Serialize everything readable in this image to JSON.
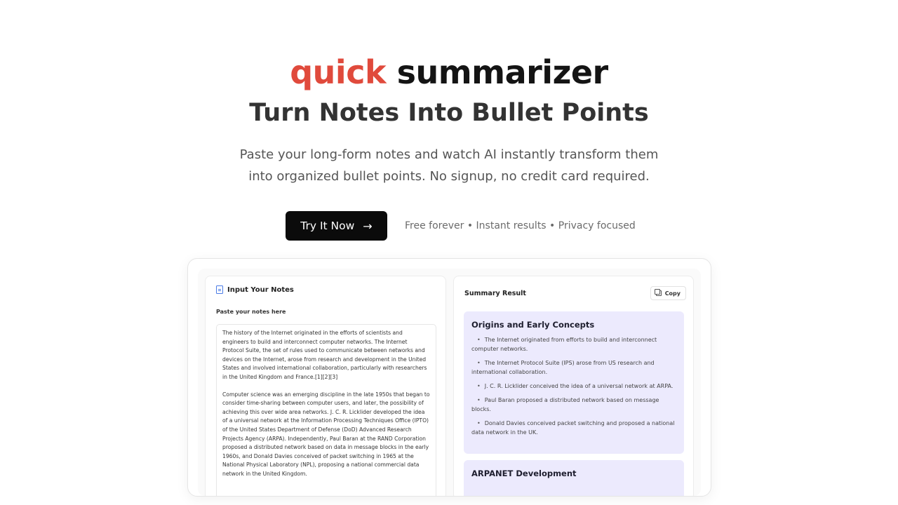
{
  "hero": {
    "title_accent": "quick",
    "title_main": "summarizer",
    "subtitle": "Turn Notes Into Bullet Points",
    "description": "Paste your long-form notes and watch AI instantly transform them into organized bullet points. No signup, no credit card required."
  },
  "cta": {
    "button_label": "Try It Now",
    "note": "Free forever • Instant results • Privacy focused"
  },
  "input_panel": {
    "title": "Input Your Notes",
    "label": "Paste your notes here",
    "paragraphs": [
      "The history of the Internet originated in the efforts of scientists and engineers to build and interconnect computer networks. The Internet Protocol Suite, the set of rules used to communicate between networks and devices on the Internet, arose from research and development in the United States and involved international collaboration, particularly with researchers in the United Kingdom and France.[1][2][3]",
      "Computer science was an emerging discipline in the late 1950s that began to consider time-sharing between computer users, and later, the possibility of achieving this over wide area networks. J. C. R. Licklider developed the idea of a universal network at the Information Processing Techniques Office (IPTO) of the United States Department of Defense (DoD) Advanced Research Projects Agency (ARPA). Independently, Paul Baran at the RAND Corporation proposed a distributed network based on data in message blocks in the early 1960s, and Donald Davies conceived of packet switching in 1965 at the National Physical Laboratory (NPL), proposing a national commercial data network in the United Kingdom."
    ]
  },
  "summary_panel": {
    "title": "Summary Result",
    "copy_label": "Copy",
    "sections": [
      {
        "title": "Origins and Early Concepts",
        "bullets": [
          "The Internet originated from efforts to build and interconnect computer networks.",
          "The Internet Protocol Suite (IPS) arose from US research and international collaboration.",
          "J. C. R. Licklider conceived the idea of a universal network at ARPA.",
          "Paul Baran proposed a distributed network based on message blocks.",
          "Donald Davies conceived packet switching and proposed a national data network in the UK."
        ]
      },
      {
        "title": "ARPANET Development",
        "bullets": []
      }
    ]
  },
  "icons": {
    "cta_arrow": "arrow-right-icon",
    "input_panel": "document-icon",
    "copy": "copy-icon"
  },
  "colors": {
    "accent": "#e04a3c",
    "cta_background": "#0b0b0b",
    "summary_card": "#eceafd"
  }
}
